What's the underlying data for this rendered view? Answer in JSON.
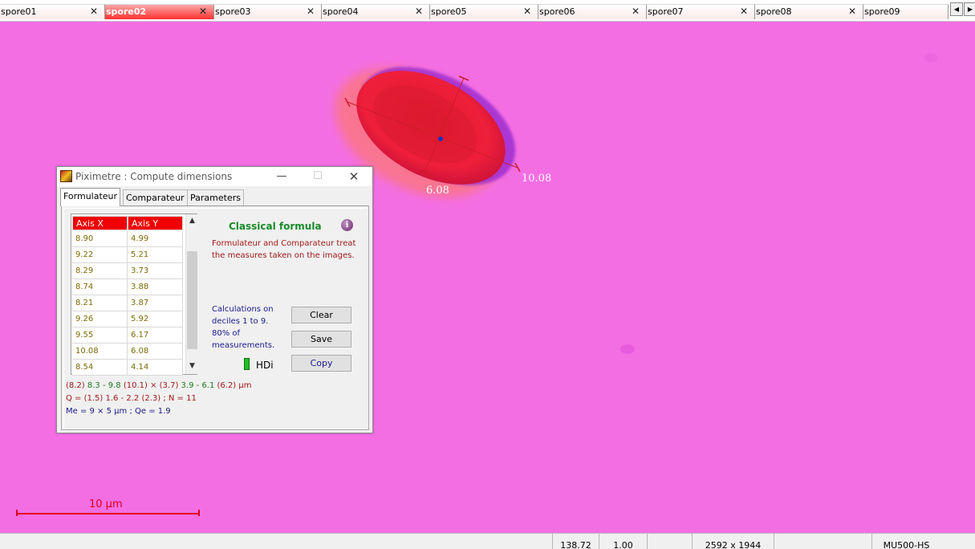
{
  "tabs": [
    {
      "label": "spore01",
      "active": false
    },
    {
      "label": "spore02",
      "active": true
    },
    {
      "label": "spore03",
      "active": false
    },
    {
      "label": "spore04",
      "active": false
    },
    {
      "label": "spore05",
      "active": false
    },
    {
      "label": "spore06",
      "active": false
    },
    {
      "label": "spore07",
      "active": false
    },
    {
      "label": "spore08",
      "active": false
    },
    {
      "label": "spore09",
      "active": false
    }
  ],
  "tab_close_glyph": "✕",
  "tab_scroll": {
    "left": "◀",
    "right": "▶"
  },
  "image": {
    "measure_long": "10.08",
    "measure_short": "6.08",
    "scale_label": "10 µm"
  },
  "statusbar": [
    "138.72",
    "1.00",
    "",
    "2592 x 1944",
    "",
    "MU500-HS"
  ],
  "dialog": {
    "title": "Piximetre : Compute dimensions",
    "min_glyph": "—",
    "max_glyph": "☐",
    "close_glyph": "✕",
    "tabs": [
      "Formulateur",
      "Comparateur",
      "Parameters"
    ],
    "grid": {
      "headers": [
        "Axis X",
        "Axis Y"
      ],
      "rows": [
        [
          "8.90",
          "4.99"
        ],
        [
          "9.22",
          "5.21"
        ],
        [
          "8.29",
          "3.73"
        ],
        [
          "8.74",
          "3.88"
        ],
        [
          "8.21",
          "3.87"
        ],
        [
          "9.26",
          "5.92"
        ],
        [
          "9.55",
          "6.17"
        ],
        [
          "10.08",
          "6.08"
        ],
        [
          "8.54",
          "4.14"
        ]
      ],
      "scroll_up": "▲",
      "scroll_down": "▼"
    },
    "formula_title": "Classical formula",
    "info_glyph": "i",
    "formula_desc": "Formulateur and Comparateur treat the measures taken on the images.",
    "calc_desc": "Calculations on deciles 1 to 9. 80% of measurements.",
    "buttons": {
      "clear": "Clear",
      "save": "Save",
      "copy": "Copy"
    },
    "hdi_label": "HDi",
    "result": {
      "line1_parts": [
        {
          "text": "(8.2) ",
          "color": "red"
        },
        {
          "text": "8.3 - 9.8 ",
          "color": "green"
        },
        {
          "text": "(10.1) ",
          "color": "red"
        },
        {
          "text": "× ",
          "color": "red"
        },
        {
          "text": "(3.7) ",
          "color": "red"
        },
        {
          "text": "3.9 - 6.1 ",
          "color": "green"
        },
        {
          "text": "(6.2) ",
          "color": "red"
        },
        {
          "text": "µm",
          "color": "red"
        }
      ],
      "line2": "Q = (1.5) 1.6 - 2.2 (2.3) ; N = 11",
      "line3": "Me = 9 × 5 µm ; Qe = 1.9"
    }
  },
  "colors": {
    "background": "#f36ee3",
    "spore": "#ee1f3a",
    "accent_red": "#f00000",
    "scale_red": "#e0001b"
  }
}
